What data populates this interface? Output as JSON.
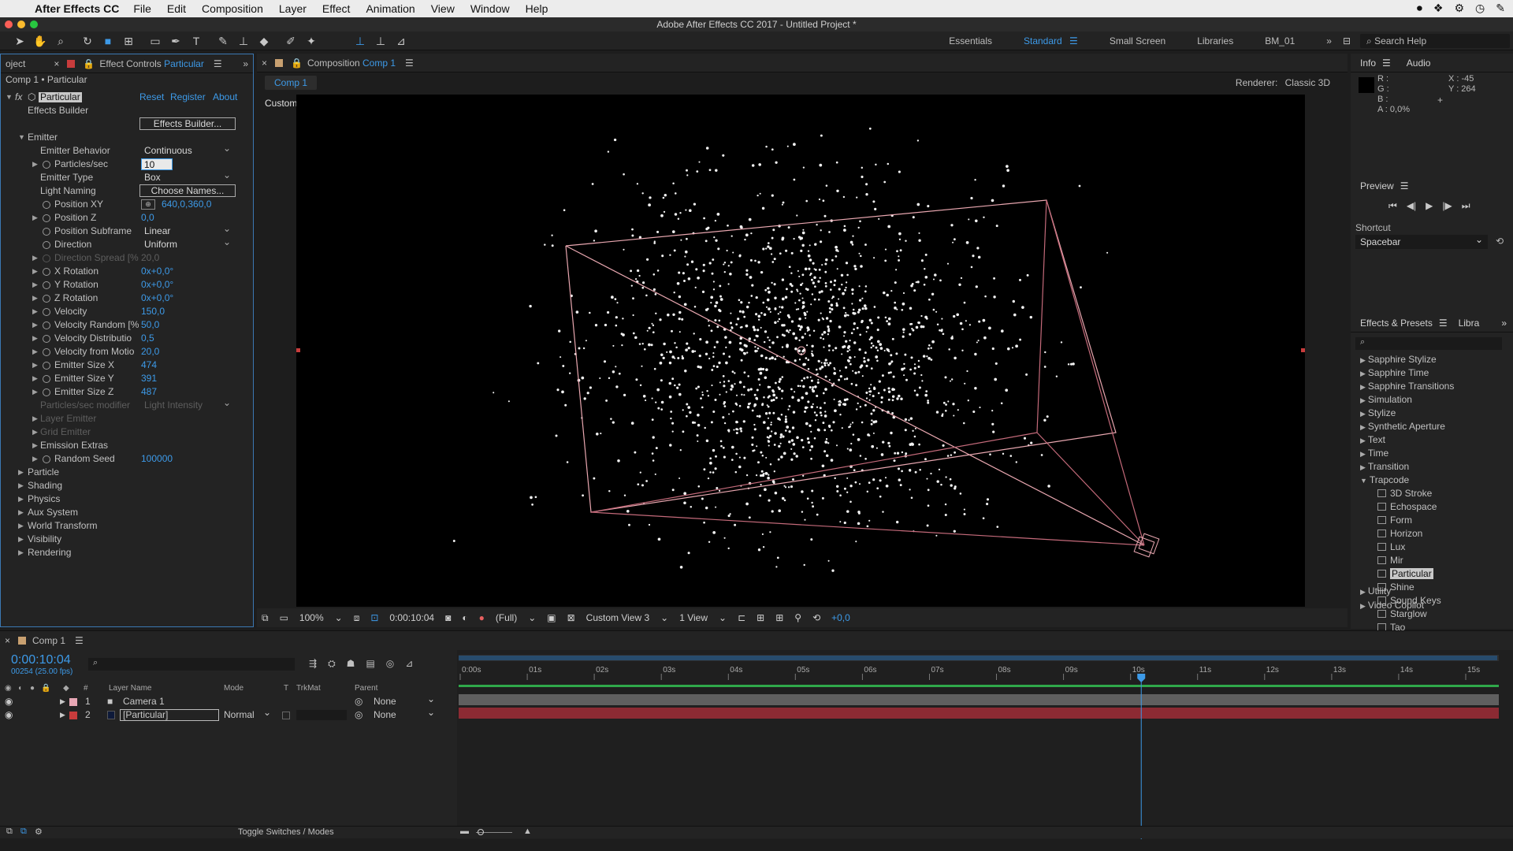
{
  "menubar": {
    "app_name": "After Effects CC",
    "items": [
      "File",
      "Edit",
      "Composition",
      "Layer",
      "Effect",
      "Animation",
      "View",
      "Window",
      "Help"
    ]
  },
  "window_title": "Adobe After Effects CC 2017 - Untitled Project *",
  "workspaces": {
    "items": [
      "Essentials",
      "Standard",
      "Small Screen",
      "Libraries",
      "BM_01"
    ],
    "active": "Standard",
    "search_placeholder": "Search Help"
  },
  "effect_controls": {
    "tab_project": "oject",
    "tab_title": "Effect Controls",
    "tab_layer": "Particular",
    "breadcrumb": "Comp 1 • Particular",
    "effect_name": "Particular",
    "reset": "Reset",
    "register": "Register",
    "about": "About",
    "effects_builder_label": "Effects Builder",
    "effects_builder_button": "Effects Builder...",
    "emitter_group": "Emitter",
    "emitter_behavior": {
      "label": "Emitter Behavior",
      "value": "Continuous"
    },
    "particles_sec": {
      "label": "Particles/sec",
      "value": "10"
    },
    "emitter_type": {
      "label": "Emitter Type",
      "value": "Box"
    },
    "light_naming": {
      "label": "Light Naming",
      "value": "Choose Names..."
    },
    "position_xy": {
      "label": "Position XY",
      "value": "640,0,360,0"
    },
    "position_z": {
      "label": "Position Z",
      "value": "0,0"
    },
    "position_subframe": {
      "label": "Position Subframe",
      "value": "Linear"
    },
    "direction": {
      "label": "Direction",
      "value": "Uniform"
    },
    "direction_spread": {
      "label": "Direction Spread [%",
      "value": "20,0"
    },
    "x_rotation": {
      "label": "X Rotation",
      "value": "0x+0,0°"
    },
    "y_rotation": {
      "label": "Y Rotation",
      "value": "0x+0,0°"
    },
    "z_rotation": {
      "label": "Z Rotation",
      "value": "0x+0,0°"
    },
    "velocity": {
      "label": "Velocity",
      "value": "150,0"
    },
    "velocity_random": {
      "label": "Velocity Random [%",
      "value": "50,0"
    },
    "velocity_distribution": {
      "label": "Velocity Distributio",
      "value": "0,5"
    },
    "velocity_from_motion": {
      "label": "Velocity from Motio",
      "value": "20,0"
    },
    "emitter_size_x": {
      "label": "Emitter Size X",
      "value": "474"
    },
    "emitter_size_y": {
      "label": "Emitter Size Y",
      "value": "391"
    },
    "emitter_size_z": {
      "label": "Emitter Size Z",
      "value": "487"
    },
    "particles_modifier": {
      "label": "Particles/sec modifier",
      "value": "Light Intensity"
    },
    "layer_emitter": "Layer Emitter",
    "grid_emitter": "Grid Emitter",
    "emission_extras": "Emission Extras",
    "random_seed": {
      "label": "Random Seed",
      "value": "100000"
    },
    "groups": [
      "Particle",
      "Shading",
      "Physics",
      "Aux System",
      "World Transform",
      "Visibility",
      "Rendering"
    ]
  },
  "composition": {
    "tab_title": "Composition",
    "tab_comp": "Comp 1",
    "comp_tab": "Comp 1",
    "renderer_label": "Renderer:",
    "renderer_value": "Classic 3D",
    "view_label": "Custom View 3",
    "footer": {
      "zoom": "100%",
      "timecode": "0:00:10:04",
      "resolution": "(Full)",
      "view": "Custom View 3",
      "view_count": "1 View",
      "exposure": "+0,0"
    }
  },
  "info_panel": {
    "tab_info": "Info",
    "tab_audio": "Audio",
    "r": "R :",
    "g": "G :",
    "b": "B :",
    "a": "A : 0,0%",
    "x": "X : -45",
    "y": "Y : 264"
  },
  "preview_panel": {
    "title": "Preview",
    "shortcut_label": "Shortcut",
    "shortcut_value": "Spacebar"
  },
  "effects_presets": {
    "tab": "Effects & Presets",
    "tab2": "Libra",
    "categories": [
      "Sapphire Stylize",
      "Sapphire Time",
      "Sapphire Transitions",
      "Simulation",
      "Stylize",
      "Synthetic Aperture",
      "Text",
      "Time",
      "Transition"
    ],
    "open_category": "Trapcode",
    "trapcode_items": [
      "3D Stroke",
      "Echospace",
      "Form",
      "Horizon",
      "Lux",
      "Mir",
      "Particular",
      "Shine",
      "Sound Keys",
      "Starglow",
      "Tao"
    ],
    "selected": "Particular",
    "after": [
      "Utility",
      "Video Copilot"
    ]
  },
  "timeline": {
    "tab": "Comp 1",
    "timecode": "0:00:10:04",
    "frames": "00254 (25.00 fps)",
    "columns": {
      "layer_name": "Layer Name",
      "mode": "Mode",
      "t": "T",
      "trkmat": "TrkMat",
      "parent": "Parent",
      "num": "#"
    },
    "layers": [
      {
        "num": "1",
        "name": "Camera 1",
        "mode": "",
        "parent": "None"
      },
      {
        "num": "2",
        "name": "[Particular]",
        "mode": "Normal",
        "parent": "None"
      }
    ],
    "ruler": [
      "0:00s",
      "01s",
      "02s",
      "03s",
      "04s",
      "05s",
      "06s",
      "07s",
      "08s",
      "09s",
      "10s",
      "11s",
      "12s",
      "13s",
      "14s",
      "15s"
    ],
    "playhead_fraction": 0.6773,
    "toggle": "Toggle Switches / Modes"
  },
  "colors": {
    "accent": "#3d9ae8",
    "camera_label": "#e7a7b4",
    "particular_bar": "#8c2a33",
    "camera_bar": "#5f5f5f",
    "emitter_box": "#e9a7b0"
  }
}
